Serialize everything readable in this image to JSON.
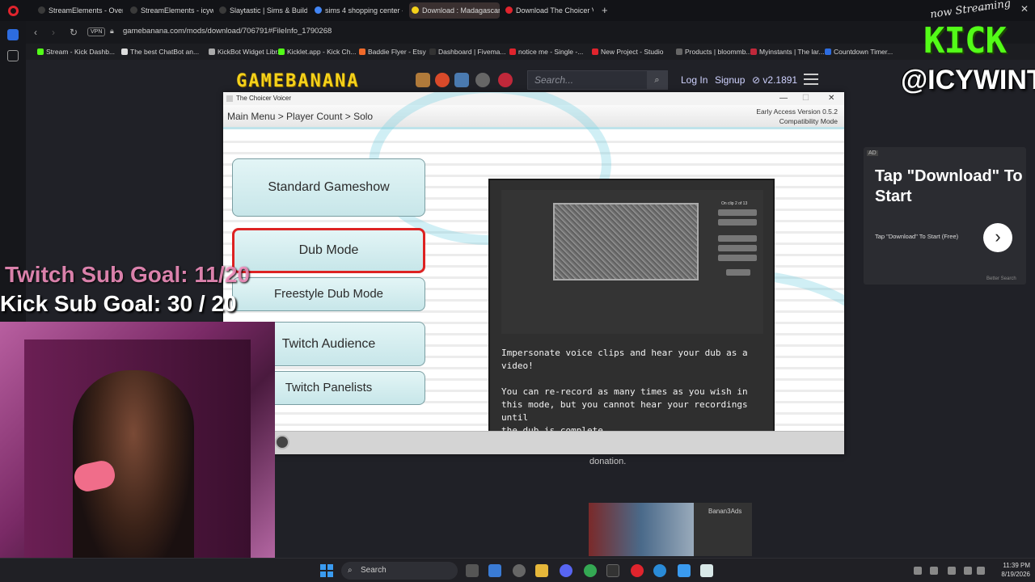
{
  "browser": {
    "tabs": [
      {
        "label": "StreamElements - Overla",
        "color": "#3a3a3a"
      },
      {
        "label": "StreamElements - icywint",
        "color": "#3a3a3a"
      },
      {
        "label": "Slaytastic | Sims & Builds",
        "color": "#3a3a3a"
      },
      {
        "label": "sims 4 shopping center - ",
        "color": "#4285f4"
      },
      {
        "label": "Download : Madagascar",
        "color": "#f5d21a",
        "active": true
      },
      {
        "label": "Download The Choicer Vo",
        "color": "#e0242d"
      }
    ],
    "new_tab": "+",
    "url": "gamebanana.com/mods/download/706791#FileInfo_1790268",
    "vpn": "VPN",
    "bookmarks": [
      "Stream - Kick Dashb...",
      "The best ChatBot an...",
      "KickBot Widget Libr...",
      "Kicklet.app - Kick Ch...",
      "Baddie Flyer - Etsy",
      "Dashboard | Fivema...",
      "notice me - Single -...",
      "New Project - Studio",
      "Products | bloommb...",
      "Myinstants | The lar...",
      "Countdown Timer..."
    ]
  },
  "gamebanana": {
    "logo": "GAMEBANANA",
    "search_placeholder": "Search...",
    "login": "Log In",
    "signup": "Signup",
    "version": "v2.1891"
  },
  "app": {
    "title": "The Choicer Voicer",
    "breadcrumb": "Main Menu > Player Count > Solo",
    "version_line1": "Early Access Version 0.5.2",
    "version_line2": "Compatibility Mode",
    "modes": [
      {
        "label": "Standard Gameshow",
        "selected": false
      },
      {
        "label": "Dub Mode",
        "selected": true
      },
      {
        "label": "Freestyle Dub Mode",
        "selected": false
      },
      {
        "label": "Twitch Audience",
        "selected": false
      },
      {
        "label": "Twitch Panelists",
        "selected": false
      }
    ],
    "preview_caption": "On clip 2 of 13",
    "description": "Impersonate voice clips and hear your dub as a video!\n\nYou can re-record as many times as you wish in\nthis mode, but you cannot hear your recordings until\nthe dub is complete.\n\nThis mode uses special \"Dub Voice Packs\" and is\nnot compatible with non-dub voice packs."
  },
  "ad": {
    "tag": "AD",
    "title": "Tap \"Download\" To Start",
    "subtitle": "Tap \"Download\" To Start (Free)",
    "arrow": "›",
    "footer": "Better Search"
  },
  "page": {
    "donation": "donation.",
    "thumb_label": "Banan3Ads"
  },
  "overlay": {
    "streaming": "now Streaming",
    "kick": "KICK",
    "handle": "@ICYWINTRR",
    "twitch_goal": "Twitch Sub Goal: 11/20",
    "kick_goal": "Kick Sub Goal: 30 / 20"
  },
  "taskbar": {
    "search": "Search",
    "time": "11:39 PM",
    "date": "8/19/2026"
  }
}
